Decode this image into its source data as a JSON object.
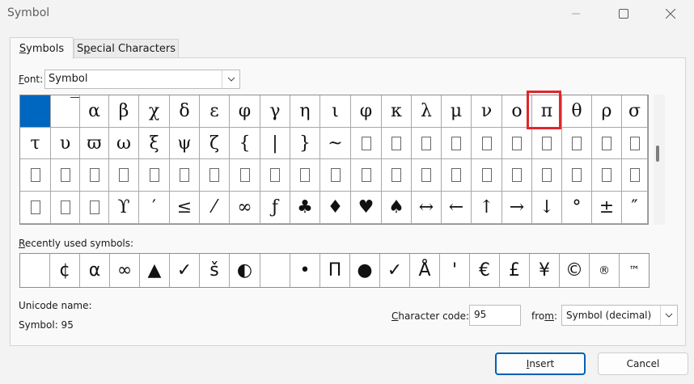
{
  "window": {
    "title": "Symbol"
  },
  "tabs": [
    {
      "label": "Symbols",
      "mnemonic": "S",
      "rest": "ymbols"
    },
    {
      "label": "Special Characters",
      "mnemonic": "p",
      "pre": "S",
      "rest": "ecial Characters"
    }
  ],
  "font": {
    "label_pre": "",
    "mnemonic": "F",
    "label_rest": "ont:",
    "value": "Symbol"
  },
  "symbol_grid": {
    "rows": [
      [
        "",
        "‾",
        "α",
        "β",
        "χ",
        "δ",
        "ε",
        "φ",
        "γ",
        "η",
        "ι",
        "φ",
        "κ",
        "λ",
        "μ",
        "ν",
        "ο",
        "π",
        "θ",
        "ρ",
        "σ"
      ],
      [
        "τ",
        "υ",
        "ϖ",
        "ω",
        "ξ",
        "ψ",
        "ζ",
        "{",
        "|",
        "}",
        "~",
        "",
        "",
        "",
        "",
        "",
        "",
        "",
        "",
        "",
        ""
      ],
      [
        "",
        "",
        "",
        "",
        "",
        "",
        "",
        "",
        "",
        "",
        "",
        "",
        "",
        "",
        "",
        "",
        "",
        "",
        "",
        "",
        ""
      ],
      [
        "",
        "",
        "",
        "ϒ",
        "′",
        "≤",
        "⁄",
        "∞",
        "ƒ",
        "♣",
        "♦",
        "♥",
        "♠",
        "↔",
        "←",
        "↑",
        "→",
        "↓",
        "°",
        "±",
        "″"
      ]
    ],
    "selected": [
      0,
      0
    ],
    "highlighted": [
      0,
      17
    ]
  },
  "recent": {
    "label_pre": "",
    "mnemonic": "R",
    "label_rest": "ecently used symbols:",
    "symbols": [
      "",
      "¢",
      "α",
      "∞",
      "▲",
      "✓",
      "š",
      "◐",
      "",
      "•",
      "Π",
      "●",
      "✓",
      "Å",
      "'",
      "€",
      "£",
      "¥",
      "©",
      "®",
      "™"
    ]
  },
  "unicode_name_label": "Unicode name:",
  "symbol_info": "Symbol: 95",
  "char_code": {
    "mnemonic": "C",
    "label_rest": "haracter code:",
    "value": "95"
  },
  "from": {
    "label_pre": "fro",
    "mnemonic": "m",
    "label_rest": ":",
    "value": "Symbol (decimal)"
  },
  "buttons": {
    "insert": {
      "mnemonic": "I",
      "rest": "nsert"
    },
    "cancel": "Cancel"
  }
}
